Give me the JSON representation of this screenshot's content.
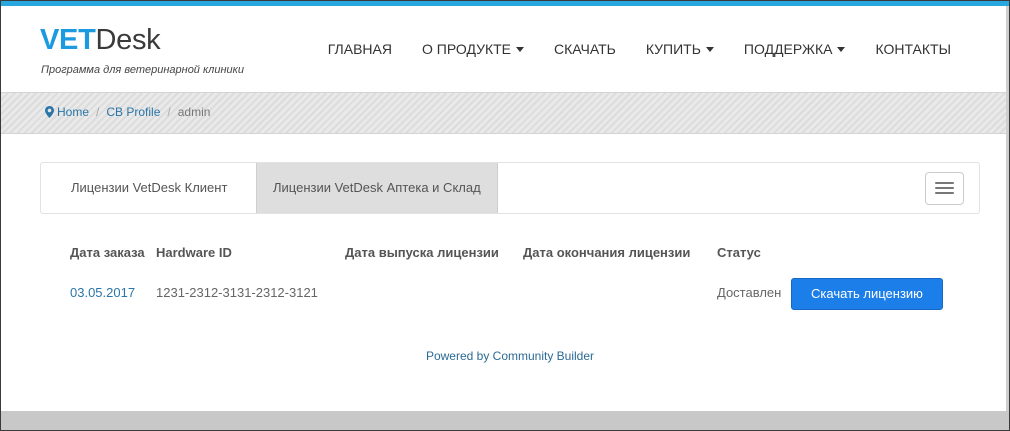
{
  "brand": {
    "logo_bold": "VET",
    "logo_rest": "Desk",
    "tagline": "Программа для ветеринарной клиники",
    "accent_color": "#1b9ae0"
  },
  "nav": {
    "items": [
      {
        "label": "ГЛАВНАЯ",
        "dropdown": false
      },
      {
        "label": "О ПРОДУКТЕ",
        "dropdown": true
      },
      {
        "label": "СКАЧАТЬ",
        "dropdown": false
      },
      {
        "label": "КУПИТЬ",
        "dropdown": true
      },
      {
        "label": "ПОДДЕРЖКА",
        "dropdown": true
      },
      {
        "label": "КОНТАКТЫ",
        "dropdown": false
      }
    ]
  },
  "breadcrumb": {
    "home": "Home",
    "profile": "CB Profile",
    "current": "admin",
    "icon": "map-marker-icon"
  },
  "tabs": [
    {
      "label": "Лицензии VetDesk Клиент",
      "active": false
    },
    {
      "label": "Лицензии VetDesk Аптека и Склад",
      "active": true
    }
  ],
  "table": {
    "headers": {
      "order_date": "Дата заказа",
      "hardware_id": "Hardware ID",
      "issue_date": "Дата выпуска лицензии",
      "expiry_date": "Дата окончания лицензии",
      "status": "Статус"
    },
    "rows": [
      {
        "order_date": "03.05.2017",
        "hardware_id": "1231-2312-3131-2312-3121",
        "issue_date": "",
        "expiry_date": "",
        "status": "Доставлен",
        "action": "Скачать лицензию"
      }
    ]
  },
  "footer": {
    "powered_by": "Powered by Community Builder"
  }
}
